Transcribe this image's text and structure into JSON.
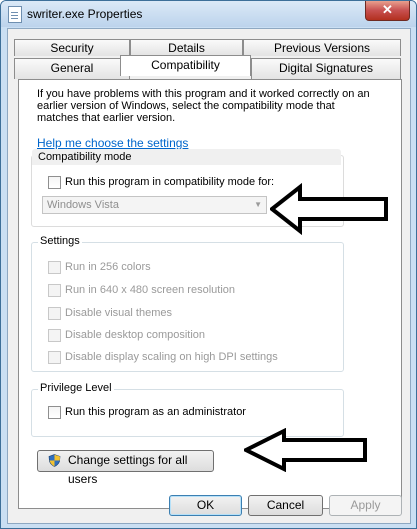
{
  "window": {
    "title": "swriter.exe Properties",
    "close_glyph": "✕"
  },
  "tabs": {
    "top_row": [
      "Security",
      "Details",
      "Previous Versions"
    ],
    "bottom_row": [
      "General",
      "Compatibility",
      "Digital Signatures"
    ],
    "active": "Compatibility"
  },
  "intro": {
    "text": "If you have problems with this program and it worked correctly on an earlier version of Windows, select the compatibility mode that matches that earlier version.",
    "help_link": "Help me choose the settings"
  },
  "compat_mode": {
    "title": "Compatibility mode",
    "checkbox_label": "Run this program in compatibility mode for:",
    "checked": false,
    "select_value": "Windows Vista"
  },
  "settings": {
    "title": "Settings",
    "items": [
      "Run in 256 colors",
      "Run in 640 x 480 screen resolution",
      "Disable visual themes",
      "Disable desktop composition",
      "Disable display scaling on high DPI settings"
    ]
  },
  "privilege": {
    "title": "Privilege Level",
    "checkbox_label": "Run this program as an administrator",
    "checked": false
  },
  "change_all_users_label": "Change settings for all users",
  "buttons": {
    "ok": "OK",
    "cancel": "Cancel",
    "apply": "Apply"
  },
  "colors": {
    "link": "#0066cc",
    "title_bar": "#cadff3",
    "close": "#c75050"
  }
}
